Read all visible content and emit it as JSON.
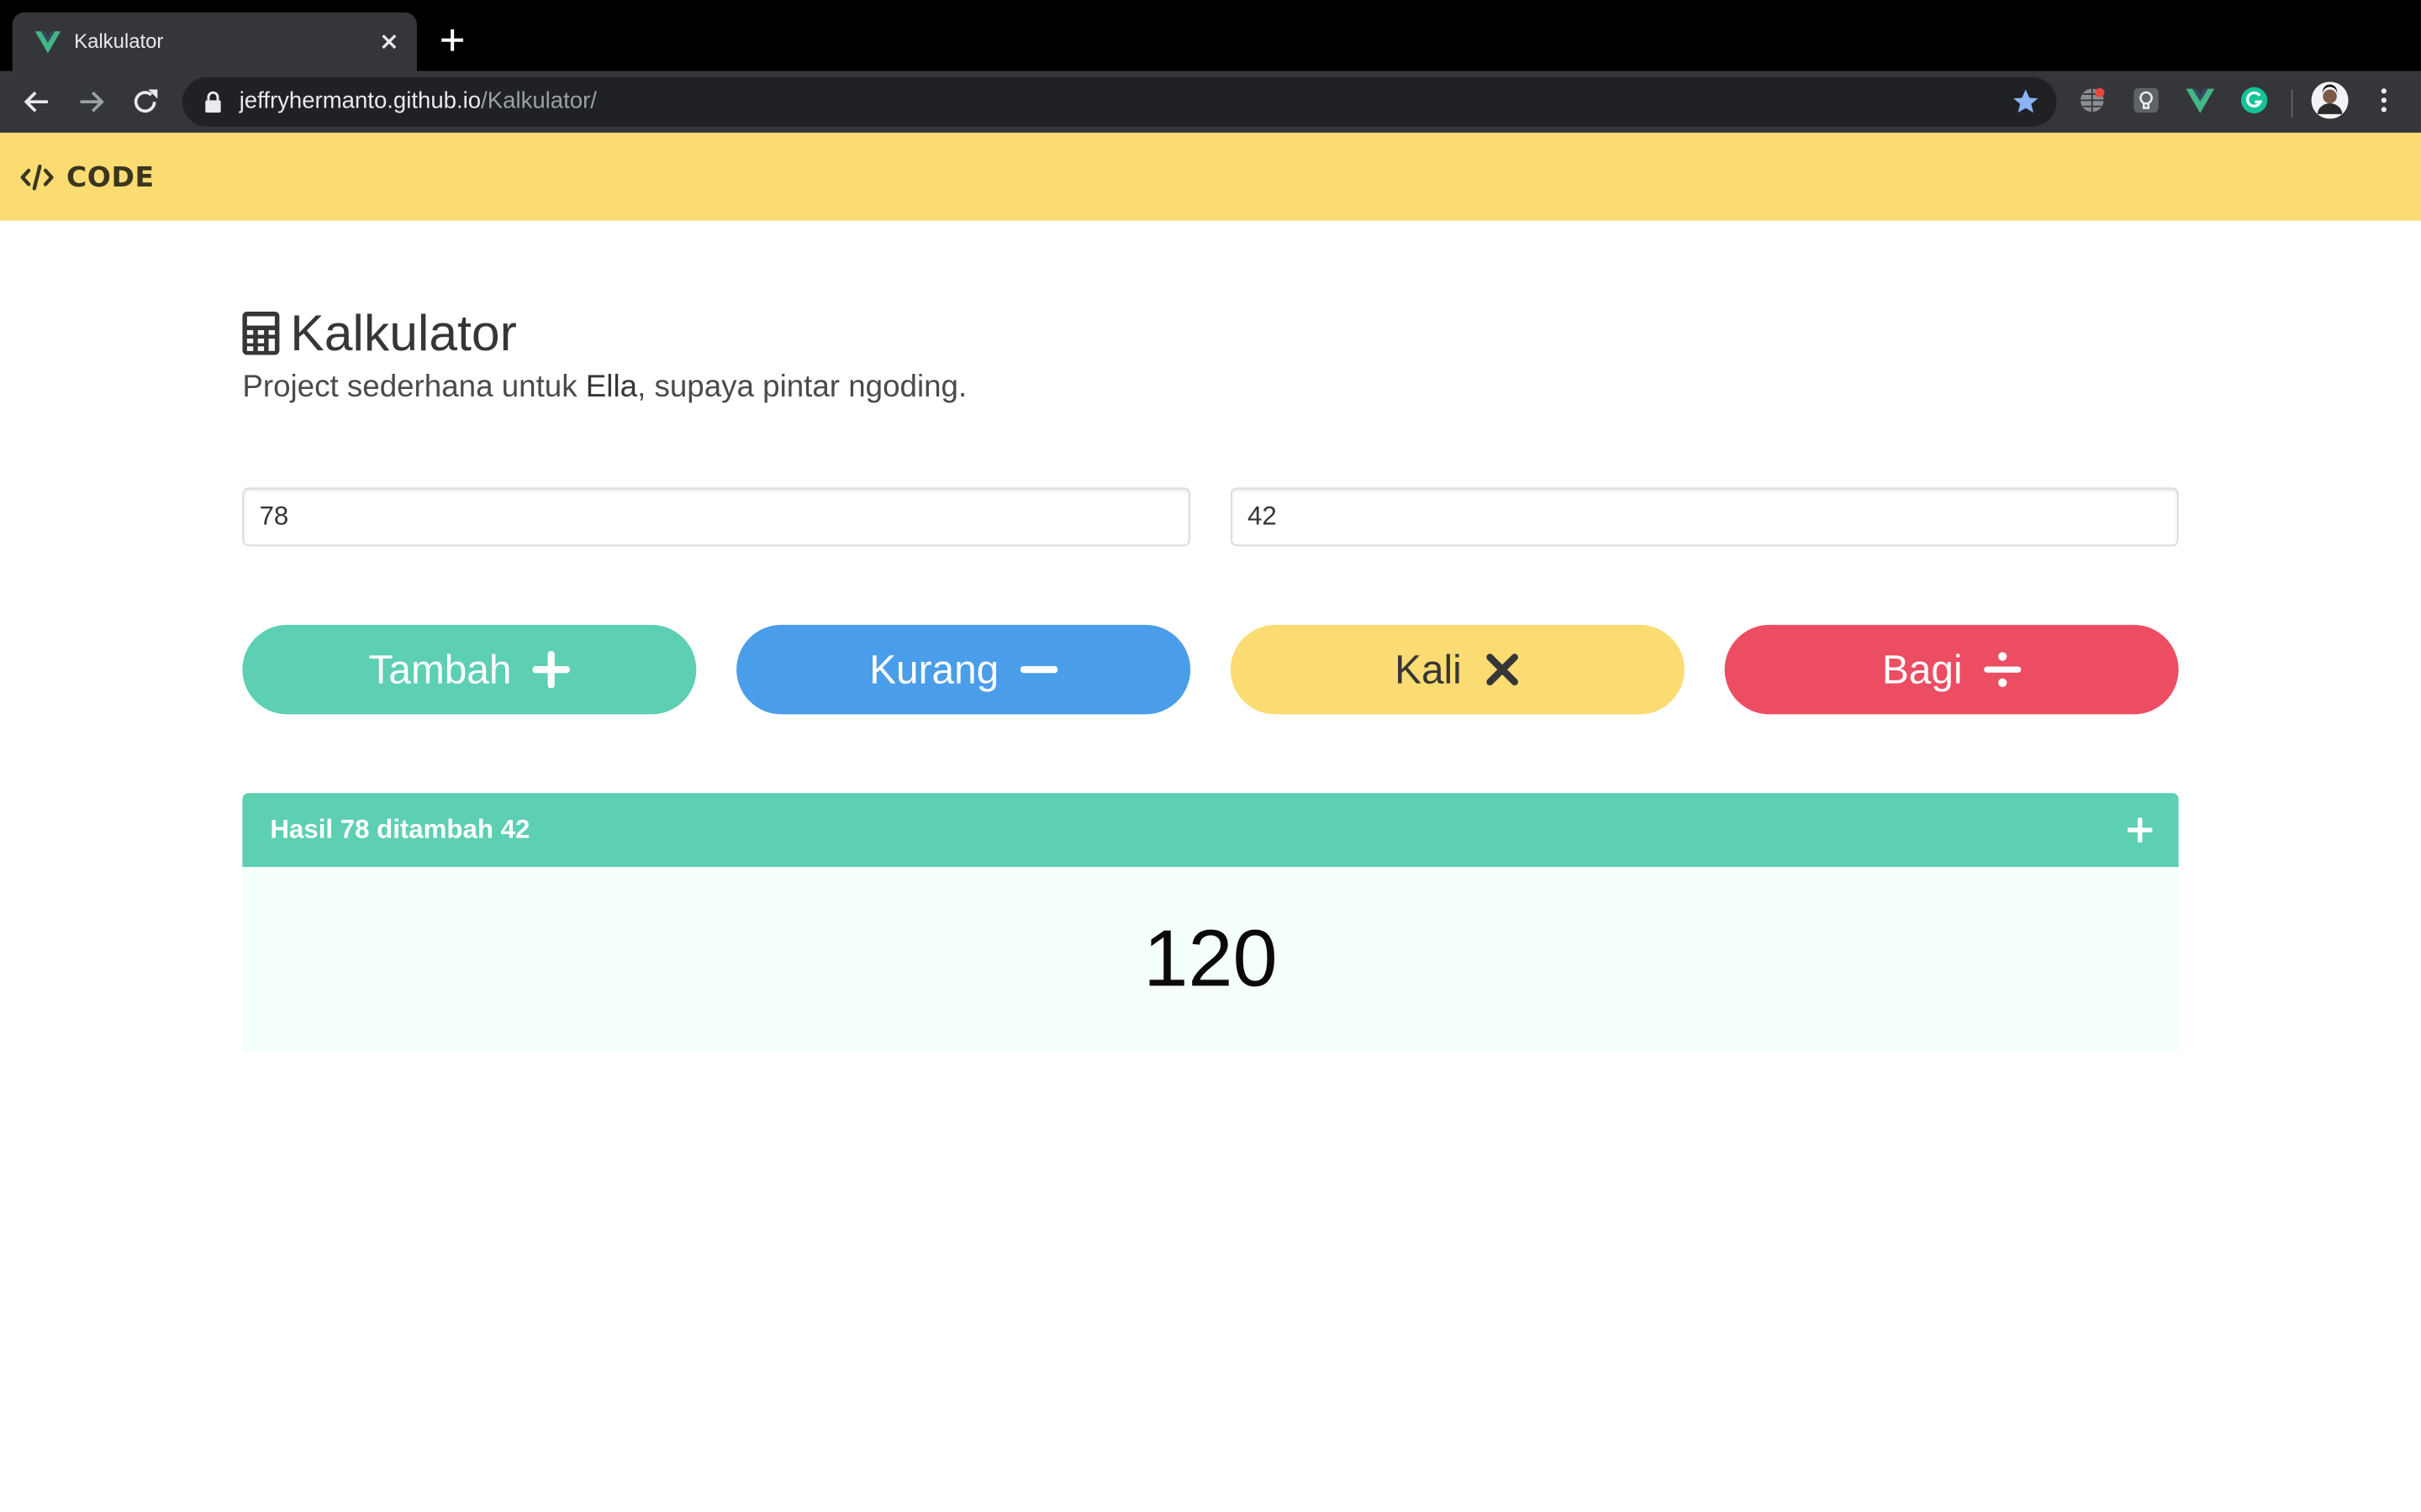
{
  "browser": {
    "tab": {
      "title": "Kalkulator",
      "favicon": "vue-logo-icon"
    },
    "url_host": "jeffryhermanto.github.io",
    "url_path": "/Kalkulator/",
    "extensions": [
      "globe-extension-icon",
      "lightbulb-extension-icon",
      "vue-devtools-icon",
      "grammarly-icon"
    ]
  },
  "navbar": {
    "brand": "CODE",
    "brand_icon": "code-icon"
  },
  "page": {
    "title": "Kalkulator",
    "title_icon": "calculator-icon",
    "subtitle_before": "Project sederhana untuk ",
    "subtitle_name": "Ella",
    "subtitle_after": ", supaya pintar ngoding."
  },
  "inputs": {
    "first": "78",
    "second": "42"
  },
  "buttons": {
    "add": "Tambah",
    "subtract": "Kurang",
    "multiply": "Kali",
    "divide": "Bagi"
  },
  "result": {
    "title": "Hasil 78 ditambah 42",
    "value": "120",
    "icon": "plus-icon"
  },
  "colors": {
    "navbar": "#fbdc72",
    "add": "#5dcfb3",
    "subtract": "#4a9de9",
    "multiply": "#fbdc72",
    "divide": "#ec4d63",
    "result_body": "#f5fffc"
  }
}
